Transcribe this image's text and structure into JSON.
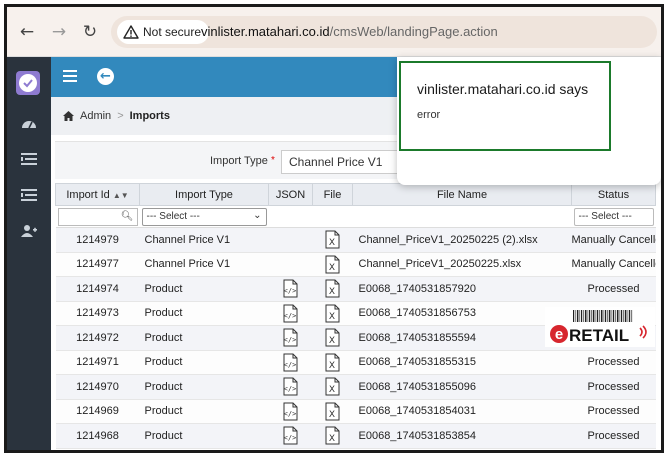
{
  "browser": {
    "secure_label": "Not secure",
    "url_host": "vinlister.matahari.co.id",
    "url_path": "/cmsWeb/landingPage.action"
  },
  "breadcrumb": {
    "home": "Admin",
    "current": "Imports"
  },
  "filter": {
    "label": "Import Type",
    "required_mark": "*",
    "value": "Channel Price V1"
  },
  "table": {
    "headers": {
      "id": "Import Id",
      "type": "Import Type",
      "json": "JSON",
      "file": "File",
      "file_name": "File Name",
      "status": "Status"
    },
    "select_placeholder": "--- Select ---",
    "rows": [
      {
        "id": "1214979",
        "type": "Channel Price V1",
        "json": false,
        "file_name": "Channel_PriceV1_20250225 (2).xlsx",
        "status": "Manually Cancelled"
      },
      {
        "id": "1214977",
        "type": "Channel Price V1",
        "json": false,
        "file_name": "Channel_PriceV1_20250225.xlsx",
        "status": "Manually Cancelled"
      },
      {
        "id": "1214974",
        "type": "Product",
        "json": true,
        "file_name": "E0068_1740531857920",
        "status": "Processed"
      },
      {
        "id": "1214973",
        "type": "Product",
        "json": true,
        "file_name": "E0068_1740531856753",
        "status": ""
      },
      {
        "id": "1214972",
        "type": "Product",
        "json": true,
        "file_name": "E0068_1740531855594",
        "status": ""
      },
      {
        "id": "1214971",
        "type": "Product",
        "json": true,
        "file_name": "E0068_1740531855315",
        "status": "Processed"
      },
      {
        "id": "1214970",
        "type": "Product",
        "json": true,
        "file_name": "E0068_1740531855096",
        "status": "Processed"
      },
      {
        "id": "1214969",
        "type": "Product",
        "json": true,
        "file_name": "E0068_1740531854031",
        "status": "Processed"
      },
      {
        "id": "1214968",
        "type": "Product",
        "json": true,
        "file_name": "E0068_1740531853854",
        "status": "Processed"
      }
    ]
  },
  "dialog": {
    "title": "vinlister.matahari.co.id says",
    "message": "error"
  },
  "logo": {
    "text": "RETAIL"
  },
  "colors": {
    "topbar": "#3289bd",
    "sidebar": "#2a333d",
    "dialog_border": "#1b7a2b",
    "logo_red": "#d7262e"
  }
}
